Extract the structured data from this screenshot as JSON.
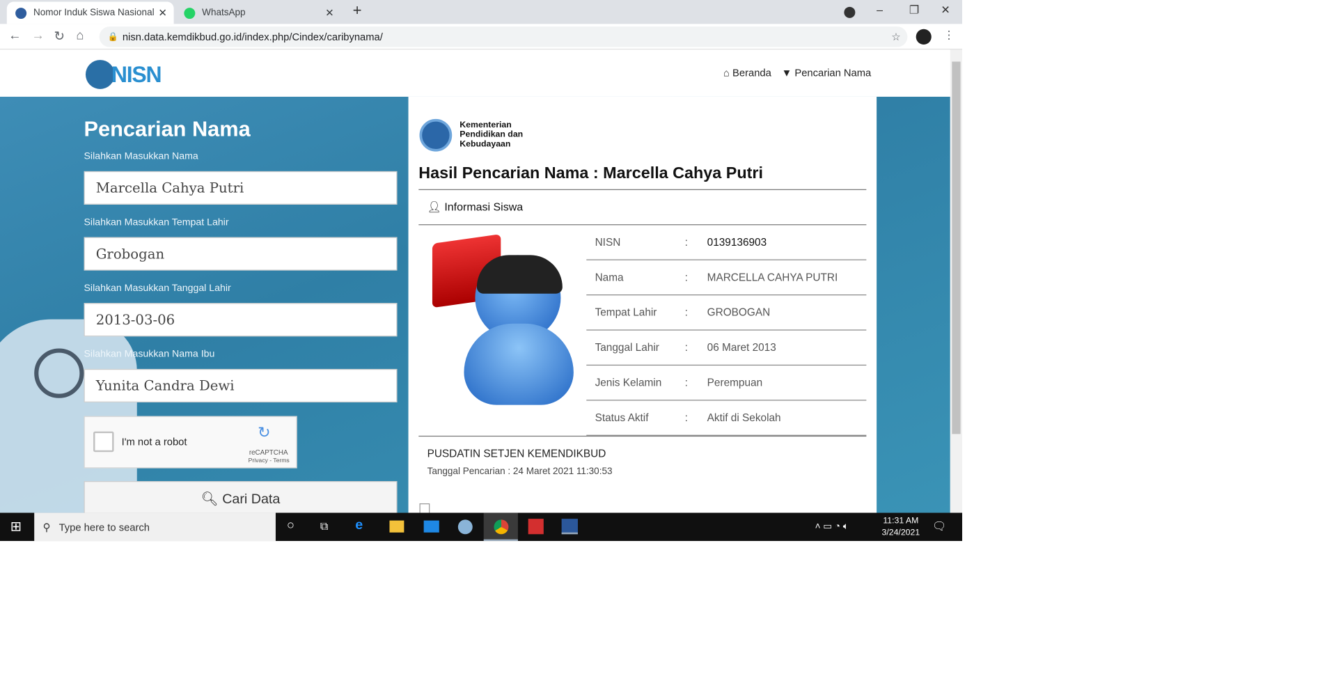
{
  "browser": {
    "tabs": [
      {
        "title": "Nomor Induk Siswa Nasional",
        "active": true
      },
      {
        "title": "WhatsApp",
        "active": false
      }
    ],
    "url": "nisn.data.kemdikbud.go.id/index.php/Cindex/caribynama/"
  },
  "header": {
    "logo_text": "NISN",
    "nav": [
      "Beranda",
      "Pencarian Nama"
    ]
  },
  "form": {
    "title": "Pencarian Nama",
    "fields": [
      {
        "label": "Silahkan Masukkan Nama",
        "value": "Marcella Cahya Putri"
      },
      {
        "label": "Silahkan Masukkan Tempat Lahir",
        "value": "Grobogan"
      },
      {
        "label": "Silahkan Masukkan Tanggal Lahir",
        "value": "2013-03-06"
      },
      {
        "label": "Silahkan Masukkan Nama Ibu",
        "value": "Yunita Candra Dewi"
      }
    ],
    "captcha": {
      "label": "I'm not a robot",
      "brand": "reCAPTCHA",
      "links": "Privacy - Terms"
    },
    "submit": "Cari Data"
  },
  "result": {
    "ministry": [
      "Kementerian",
      "Pendidikan dan",
      "Kebudayaan"
    ],
    "heading": "Hasil Pencarian Nama : Marcella Cahya Putri",
    "section": "Informasi Siswa",
    "rows": [
      {
        "k": "NISN",
        "v": "0139136903"
      },
      {
        "k": "Nama",
        "v": "MARCELLA CAHYA PUTRI"
      },
      {
        "k": "Tempat Lahir",
        "v": "GROBOGAN"
      },
      {
        "k": "Tanggal Lahir",
        "v": "06 Maret 2013"
      },
      {
        "k": "Jenis Kelamin",
        "v": "Perempuan"
      },
      {
        "k": "Status Aktif",
        "v": "Aktif di Sekolah"
      }
    ],
    "footer": "PUSDATIN SETJEN KEMENDIKBUD",
    "search_date": "Tanggal Pencarian : 24 Maret 2021 11:30:53"
  },
  "taskbar": {
    "search_placeholder": "Type here to search",
    "time": "11:31 AM",
    "date": "3/24/2021"
  }
}
